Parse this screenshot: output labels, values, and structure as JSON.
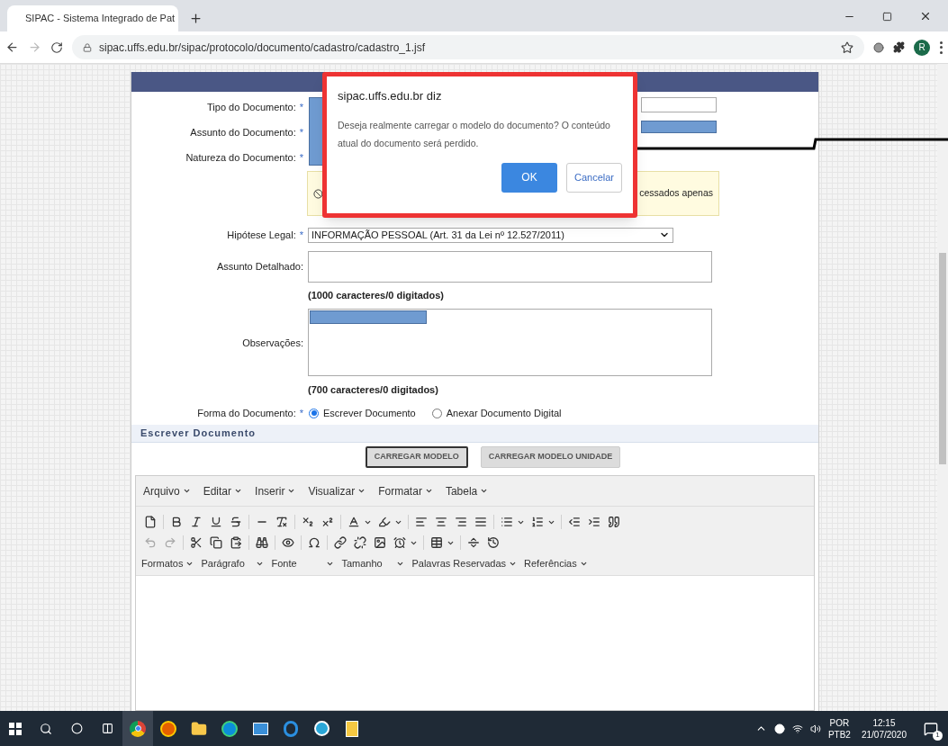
{
  "browser": {
    "tab_title": "SIPAC - Sistema Integrado de Pat",
    "url": "sipac.uffs.edu.br/sipac/protocolo/documento/cadastro/cadastro_1.jsf",
    "profile_initial": "R"
  },
  "form": {
    "fields": [
      {
        "label": "Tipo do Documento:",
        "marker": "*",
        "kind": "redacted"
      },
      {
        "label": "Assunto do Documento:",
        "marker": "*",
        "kind": "redacted"
      },
      {
        "label": "Natureza do Documento:",
        "marker": "*",
        "kind": "redacted"
      }
    ],
    "notice": {
      "text": "cessados apenas"
    },
    "hipotese": {
      "label": "Hipótese Legal:",
      "marker": "*",
      "value": "INFORMAÇÃO PESSOAL (Art. 31 da Lei nº 12.527/2011)"
    },
    "assunto_detalhado": {
      "label": "Assunto Detalhado:",
      "counter": "(1000 caracteres/0 digitados)"
    },
    "observacoes": {
      "label": "Observações:",
      "counter": "(700 caracteres/0 digitados)"
    },
    "forma": {
      "label": "Forma do Documento:",
      "marker": "*",
      "options": [
        {
          "label": "Escrever Documento",
          "selected": true
        },
        {
          "label": "Anexar Documento Digital",
          "selected": false
        }
      ]
    }
  },
  "section_title": "Escrever Documento",
  "buttons": [
    {
      "label": "CARREGAR MODELO",
      "focused": true
    },
    {
      "label": "CARREGAR MODELO UNIDADE",
      "focused": false
    }
  ],
  "editor": {
    "menus": [
      "Arquivo",
      "Editar",
      "Inserir",
      "Visualizar",
      "Formatar",
      "Tabela"
    ],
    "format_menus": [
      {
        "label": "Formatos",
        "kind": "menu"
      },
      {
        "label": "Parágrafo",
        "kind": "select"
      },
      {
        "label": "Fonte",
        "kind": "select"
      },
      {
        "label": "Tamanho",
        "kind": "select"
      },
      {
        "label": "Palavras Reservadas",
        "kind": "menu"
      },
      {
        "label": "Referências",
        "kind": "menu"
      }
    ]
  },
  "dialog": {
    "title": "sipac.uffs.edu.br diz",
    "message": "Deseja realmente carregar o modelo do documento? O conteúdo atual do documento será perdido.",
    "ok": "OK",
    "cancel": "Cancelar"
  },
  "taskbar": {
    "language": "POR",
    "layout": "PTB2",
    "time": "12:15",
    "date": "21/07/2020",
    "notifications": "1"
  }
}
